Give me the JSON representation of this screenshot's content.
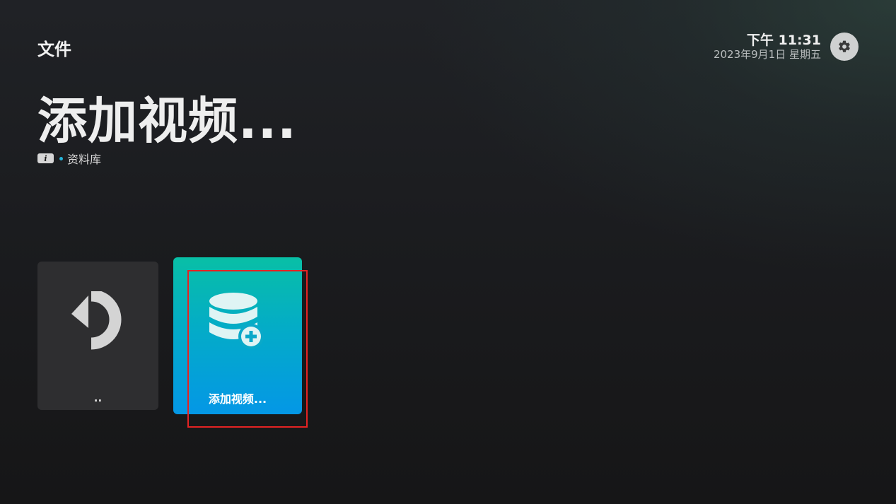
{
  "header": {
    "section_title": "文件",
    "time": "下午 11:31",
    "date": "2023年9月1日 星期五",
    "settings_icon": "gear-icon"
  },
  "page": {
    "title": "添加视频...",
    "breadcrumb": {
      "info_icon_text": "i",
      "location": "资料库"
    }
  },
  "tiles": [
    {
      "label": "..",
      "icon": "undo-arrow-icon",
      "color": "#2e2e30"
    },
    {
      "label": "添加视频...",
      "icon": "database-add-icon",
      "gradient": [
        "#08bfa6",
        "#0497e6"
      ]
    }
  ],
  "colors": {
    "accent_dot": "#25b4d9",
    "selection_outline": "#e52323"
  }
}
